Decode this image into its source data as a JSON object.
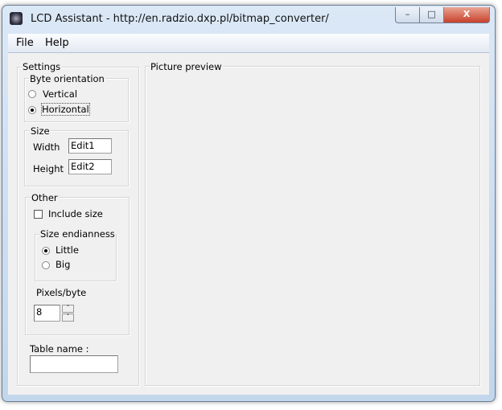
{
  "window": {
    "title": "LCD Assistant -  http://en.radzio.dxp.pl/bitmap_converter/",
    "minimize": "–",
    "maximize": "□",
    "close": "X"
  },
  "menu": [
    "File",
    "Help"
  ],
  "settings": {
    "label": "Settings",
    "byte_orientation": {
      "label": "Byte orientation",
      "options": [
        "Vertical",
        "Horizontal"
      ],
      "selected": "Horizontal"
    },
    "size": {
      "label": "Size",
      "width_label": "Width",
      "width_value": "Edit1",
      "height_label": "Height",
      "height_value": "Edit2"
    },
    "other": {
      "label": "Other",
      "include_size": "Include size",
      "include_size_checked": false,
      "endianness": {
        "label": "Size endianness",
        "options": [
          "Little",
          "Big"
        ],
        "selected": "Little"
      },
      "pixels_label": "Pixels/byte",
      "pixels_value": "8",
      "spin_up": "˄",
      "spin_down": "˅"
    },
    "table_name_label": "Table name :",
    "table_name_value": ""
  },
  "preview": {
    "label": "Picture preview"
  }
}
